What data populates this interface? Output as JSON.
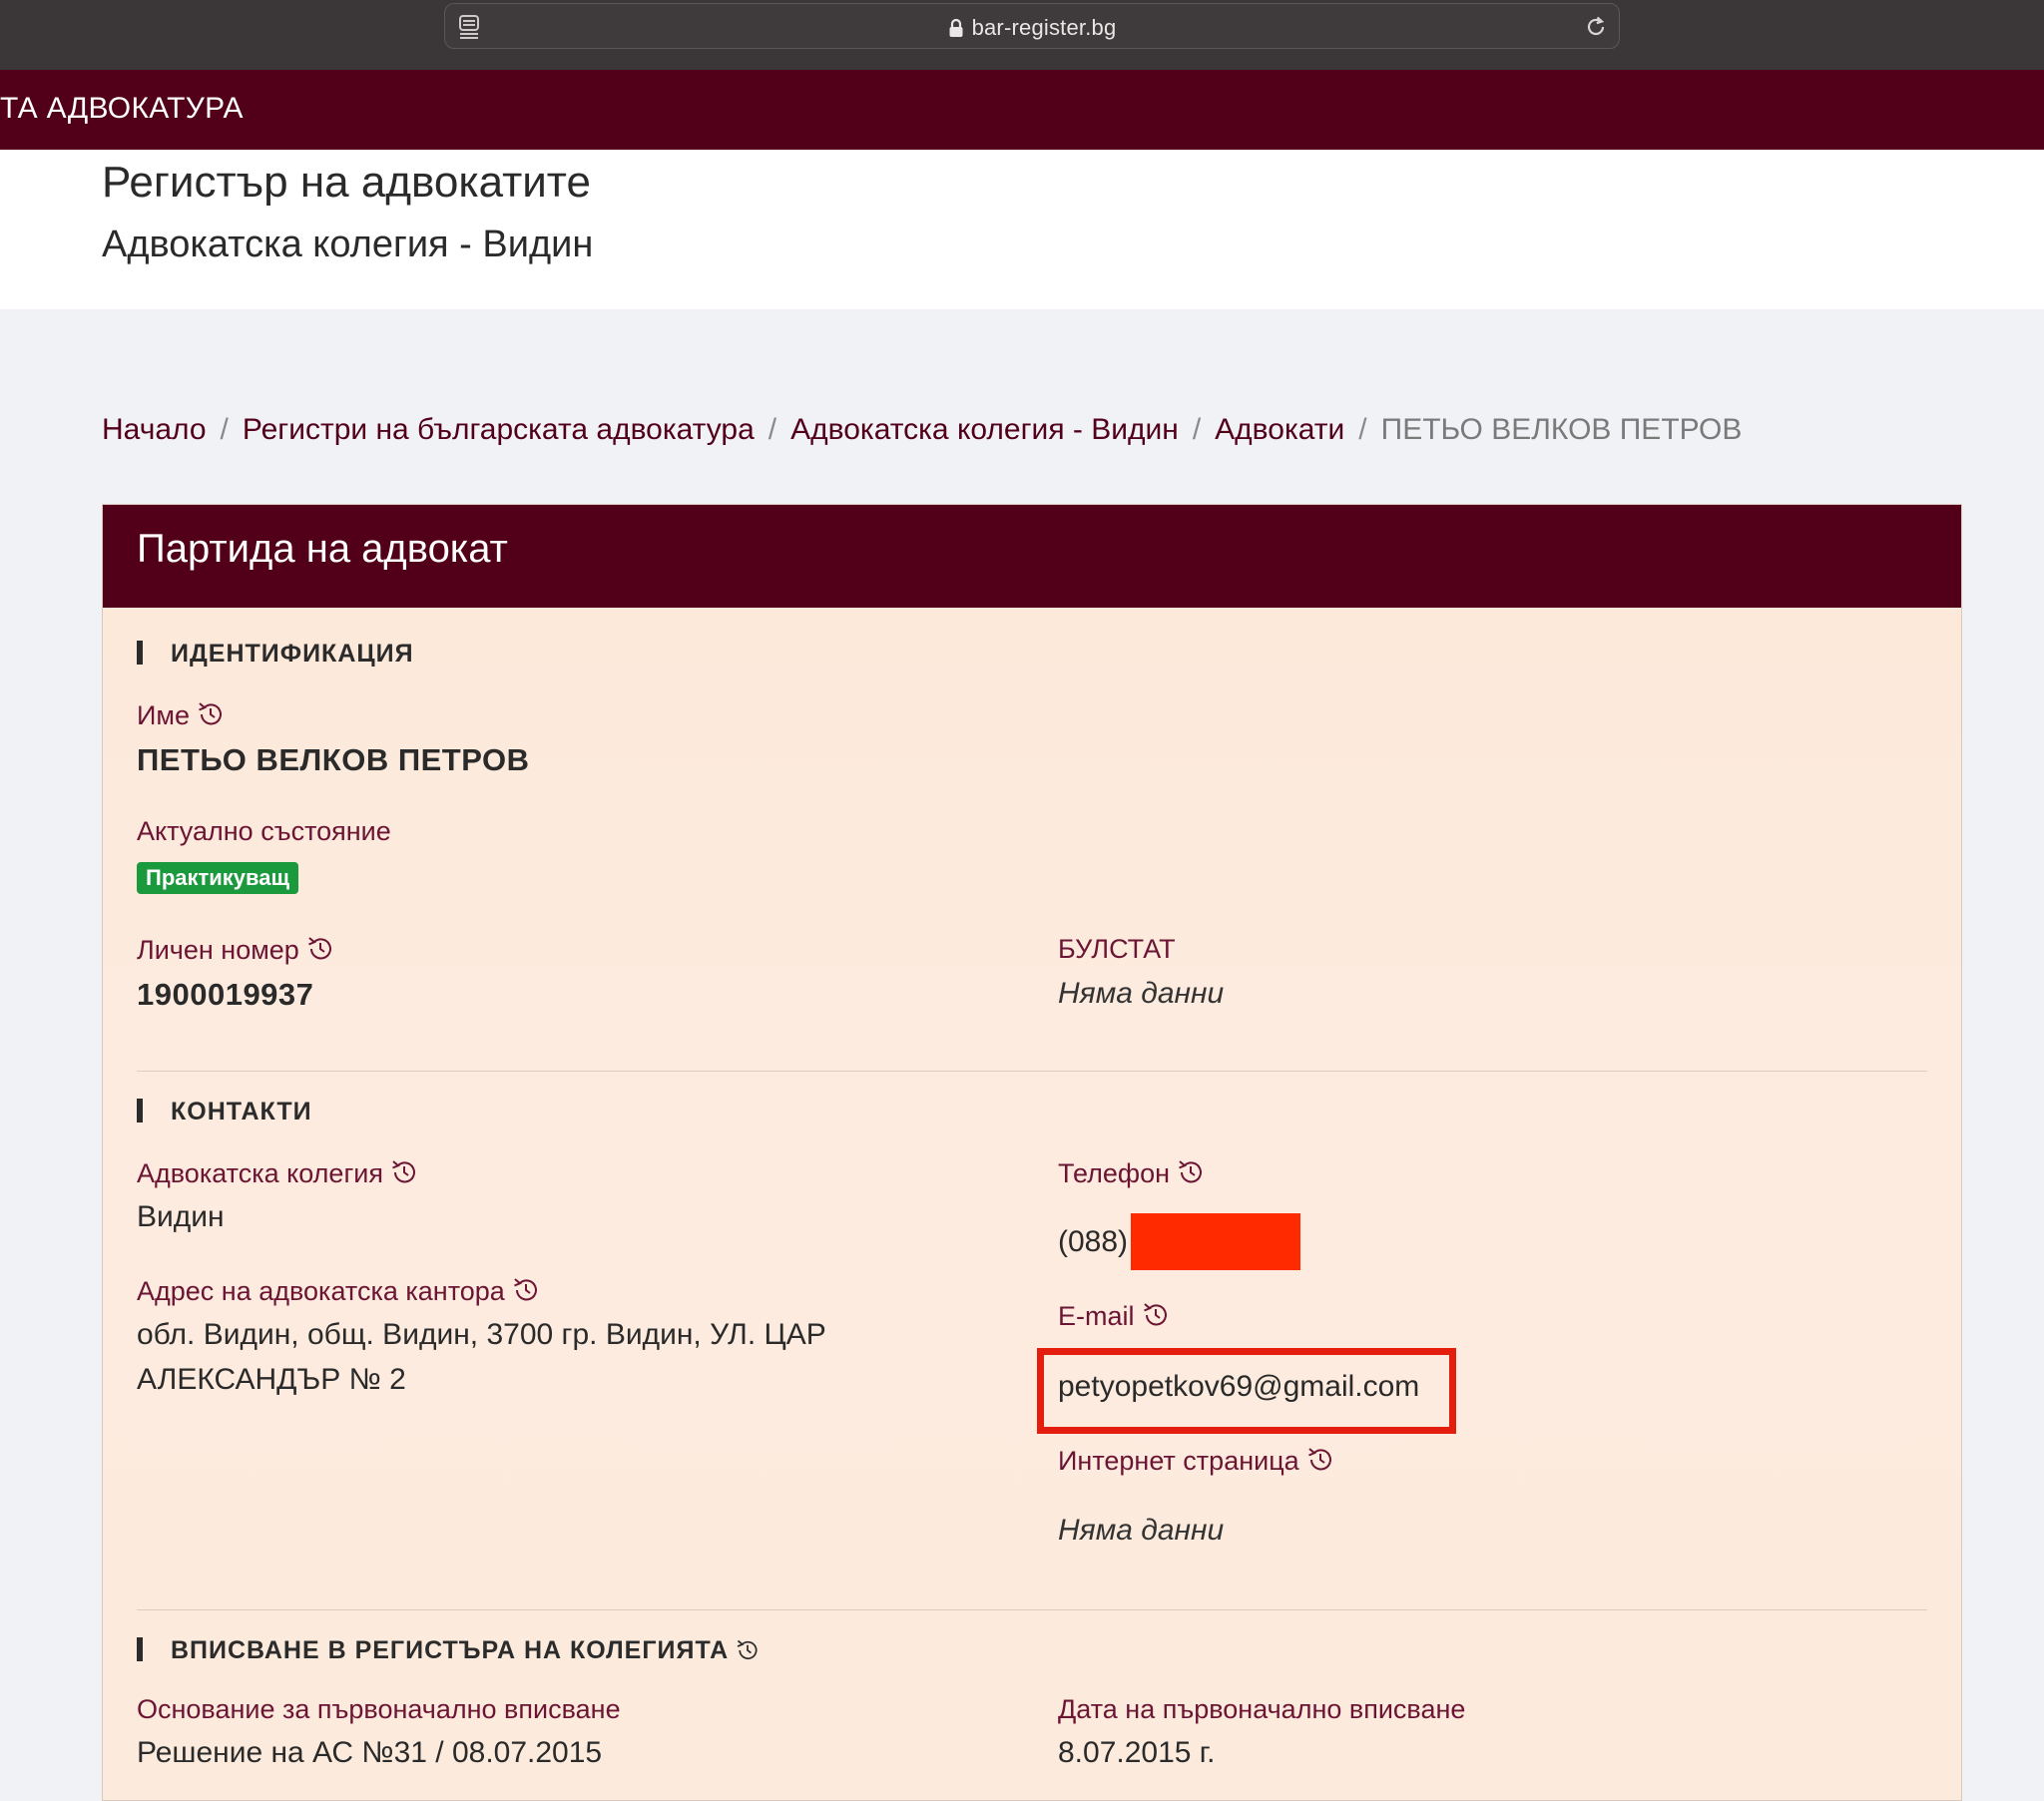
{
  "browser": {
    "url": "bar-register.bg",
    "icons": [
      "reader-icon",
      "lock-icon",
      "reload-icon"
    ]
  },
  "site": {
    "name": "ТА АДВОКАТУРА"
  },
  "header": {
    "title": "Регистър на адвокатите",
    "subtitle": "Адвокатска колегия - Видин"
  },
  "breadcrumb": {
    "items": [
      "Начало",
      "Регистри на българската адвокатура",
      "Адвокатска колегия - Видин",
      "Адвокати"
    ],
    "current": "ПЕТЬО ВЕЛКОВ ПЕТРОВ",
    "separator": "/"
  },
  "card": {
    "title": "Партида на адвокат",
    "identification": {
      "heading": "ИДЕНТИФИКАЦИЯ",
      "name_label": "Име",
      "name_value": "ПЕТЬО ВЕЛКОВ ПЕТРОВ",
      "status_label": "Актуално състояние",
      "status_value": "Практикуващ",
      "id_label": "Личен номер",
      "id_value": "1900019937",
      "bulstat_label": "БУЛСТАТ",
      "bulstat_value": "Няма данни"
    },
    "contacts": {
      "heading": "КОНТАКТИ",
      "bar_label": "Адвокатска колегия",
      "bar_value": "Видин",
      "address_label": "Адрес на адвокатска кантора",
      "address_line1": "обл. Видин, общ. Видин, 3700 гр. Видин, УЛ. ЦАР",
      "address_line2": "АЛЕКСАНДЪР № 2",
      "phone_label": "Телефон",
      "phone_value": "(088)",
      "email_label": "E-mail",
      "email_value": "petyopetkov69@gmail.com",
      "web_label": "Интернет страница",
      "web_value": "Няма данни"
    },
    "registration": {
      "heading": "ВПИСВАНЕ В РЕГИСТЪРА НА КОЛЕГИЯТА",
      "basis_label": "Основание за първоначално вписване",
      "basis_value": "Решение на АС №31 / 08.07.2015",
      "date_label": "Дата на първоначално вписване",
      "date_value": "8.07.2015 г."
    }
  },
  "colors": {
    "brand": "#52001a",
    "badge_green": "#1a9a3c",
    "label": "#6b1433",
    "card_bg": "#fcebdd",
    "redaction": "#ff2a00",
    "highlight": "#e31e0e"
  }
}
